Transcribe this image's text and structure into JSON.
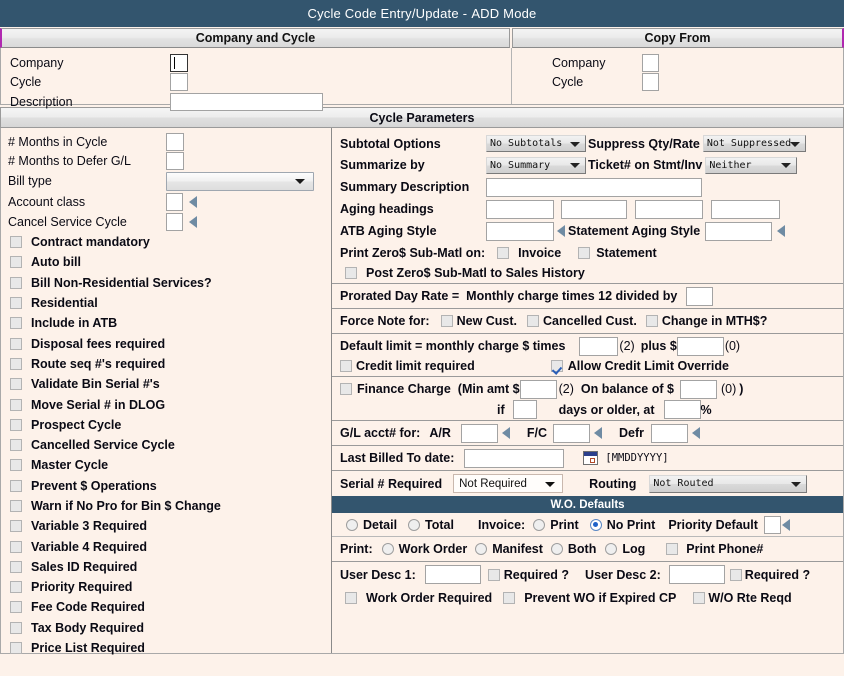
{
  "window": {
    "title": "Cycle Code Entry/Update",
    "separator": "-",
    "mode": "ADD Mode"
  },
  "tabs": {
    "company_and_cycle": "Company and Cycle",
    "copy_from": "Copy From"
  },
  "company_panel": {
    "company_label": "Company",
    "company_value": "",
    "cycle_label": "Cycle",
    "cycle_value": "",
    "description_label": "Description",
    "description_value": ""
  },
  "copy_from_panel": {
    "company_label": "Company",
    "company_value": "",
    "cycle_label": "Cycle",
    "cycle_value": ""
  },
  "parameters_header": "Cycle Parameters",
  "left": {
    "months_in_cycle_label": "# Months in Cycle",
    "months_in_cycle_value": "",
    "months_to_defer_label": "# Months to Defer G/L",
    "months_to_defer_value": "",
    "bill_type_label": "Bill type",
    "bill_type_value": "",
    "account_class_label": "Account class",
    "account_class_value": "",
    "cancel_service_cycle_label": "Cancel Service Cycle",
    "cancel_service_cycle_value": "",
    "checkboxes": [
      {
        "label": "Contract mandatory",
        "checked": false
      },
      {
        "label": "Auto bill",
        "checked": false
      },
      {
        "label": "Bill Non-Residential Services?",
        "checked": false
      },
      {
        "label": "Residential",
        "checked": false
      },
      {
        "label": "Include in ATB",
        "checked": false
      },
      {
        "label": "Disposal fees required",
        "checked": false
      },
      {
        "label": "Route seq #'s required",
        "checked": false
      },
      {
        "label": "Validate Bin Serial #'s",
        "checked": false
      },
      {
        "label": "Move Serial # in DLOG",
        "checked": false
      },
      {
        "label": "Prospect Cycle",
        "checked": false
      },
      {
        "label": "Cancelled Service Cycle",
        "checked": false
      },
      {
        "label": "Master Cycle",
        "checked": false
      },
      {
        "label": "Prevent $ Operations",
        "checked": false
      },
      {
        "label": "Warn if No Pro for Bin $ Change",
        "checked": false
      },
      {
        "label": "Variable 3 Required",
        "checked": false
      },
      {
        "label": "Variable 4 Required",
        "checked": false
      },
      {
        "label": "Sales ID Required",
        "checked": false
      },
      {
        "label": "Priority Required",
        "checked": false
      },
      {
        "label": "Fee Code Required",
        "checked": false
      },
      {
        "label": "Tax Body Required",
        "checked": false
      },
      {
        "label": "Price List Required",
        "checked": false
      }
    ]
  },
  "right": {
    "subtotal_options_label": "Subtotal Options",
    "subtotal_options_value": "No Subtotals",
    "suppress_qty_rate_label": "Suppress Qty/Rate",
    "suppress_qty_rate_value": "Not Suppressed",
    "summarize_by_label": "Summarize by",
    "summarize_by_value": "No Summary",
    "ticket_on_stmt_label": "Ticket# on Stmt/Inv",
    "ticket_on_stmt_value": "Neither",
    "summary_description_label": "Summary Description",
    "summary_description_value": "",
    "aging_headings_label": "Aging headings",
    "aging_headings_values": [
      "",
      "",
      "",
      ""
    ],
    "atb_aging_style_label": "ATB Aging Style",
    "atb_aging_style_value": "",
    "statement_aging_style_label": "Statement Aging Style",
    "statement_aging_style_value": "",
    "print_zero_label": "Print Zero$ Sub-Matl on:",
    "print_zero_invoice_label": "Invoice",
    "print_zero_invoice_checked": false,
    "print_zero_statement_label": "Statement",
    "print_zero_statement_checked": false,
    "post_zero_label": "Post Zero$ Sub-Matl to Sales History",
    "post_zero_checked": false,
    "prorated_label": "Prorated Day Rate =",
    "prorated_text": "Monthly charge times 12 divided by",
    "prorated_value": "",
    "force_note_label": "Force Note for:",
    "force_new_cust_label": "New Cust.",
    "force_new_cust_checked": false,
    "force_cancelled_cust_label": "Cancelled Cust.",
    "force_cancelled_cust_checked": false,
    "force_change_mth_label": "Change in MTH$?",
    "force_change_mth_checked": false,
    "default_limit_label": "Default limit = monthly charge $ times",
    "default_limit_times_value": "",
    "default_limit_times_hint": "(2)",
    "default_limit_plus_label": "plus $",
    "default_limit_plus_value": "",
    "default_limit_plus_hint": "(0)",
    "credit_limit_required_label": "Credit limit required",
    "credit_limit_required_checked": false,
    "allow_credit_override_label": "Allow Credit Limit Override",
    "allow_credit_override_checked": true,
    "finance_charge_label": "Finance Charge",
    "finance_charge_checked": false,
    "finance_min_amt_label": "(Min amt $",
    "finance_min_amt_value": "",
    "finance_min_amt_hint": "(2)",
    "finance_on_balance_label": "On balance of $",
    "finance_on_balance_value": "",
    "finance_on_balance_hint": "(0)",
    "finance_close_paren": ")",
    "finance_if_label": "if",
    "finance_if_value": "",
    "finance_days_label": "days or older, at",
    "finance_rate_value": "",
    "finance_pct_label": "%",
    "gl_acct_label": "G/L acct# for:",
    "gl_ar_label": "A/R",
    "gl_ar_value": "",
    "gl_fc_label": "F/C",
    "gl_fc_value": "",
    "gl_defr_label": "Defr",
    "gl_defr_value": "",
    "last_billed_label": "Last Billed To date:",
    "last_billed_value": "",
    "last_billed_format": "[MMDDYYYY]",
    "serial_required_label": "Serial # Required",
    "serial_required_value": "Not Required",
    "routing_label": "Routing",
    "routing_value": "Not Routed",
    "wo_defaults_header": "W.O. Defaults",
    "wo_detail_label": "Detail",
    "wo_detail_on": false,
    "wo_total_label": "Total",
    "wo_total_on": false,
    "wo_invoice_label": "Invoice:",
    "wo_print_label": "Print",
    "wo_print_on": false,
    "wo_noprint_label": "No Print",
    "wo_noprint_on": true,
    "wo_priority_default_label": "Priority Default",
    "wo_priority_default_value": "",
    "print_label": "Print:",
    "print_work_order_label": "Work Order",
    "print_work_order_on": false,
    "print_manifest_label": "Manifest",
    "print_manifest_on": false,
    "print_both_label": "Both",
    "print_both_on": false,
    "print_log_label": "Log",
    "print_log_on": false,
    "print_phone_label": "Print Phone#",
    "print_phone_checked": false,
    "user_desc1_label": "User Desc 1:",
    "user_desc1_value": "",
    "user_desc1_required_label": "Required ?",
    "user_desc1_required_checked": false,
    "user_desc2_label": "User Desc 2:",
    "user_desc2_value": "",
    "user_desc2_required_label": "Required ?",
    "user_desc2_required_checked": false,
    "work_order_required_label": "Work Order Required",
    "work_order_required_checked": false,
    "prevent_wo_expired_label": "Prevent WO if Expired CP",
    "prevent_wo_expired_checked": false,
    "wo_rte_reqd_label": "W/O Rte Reqd",
    "wo_rte_reqd_checked": false
  },
  "colors": {
    "titlebar": "#33556e",
    "background": "#fdf2ea",
    "accent_check": "#2b5fb8",
    "tab_edge": "#b028b0"
  }
}
